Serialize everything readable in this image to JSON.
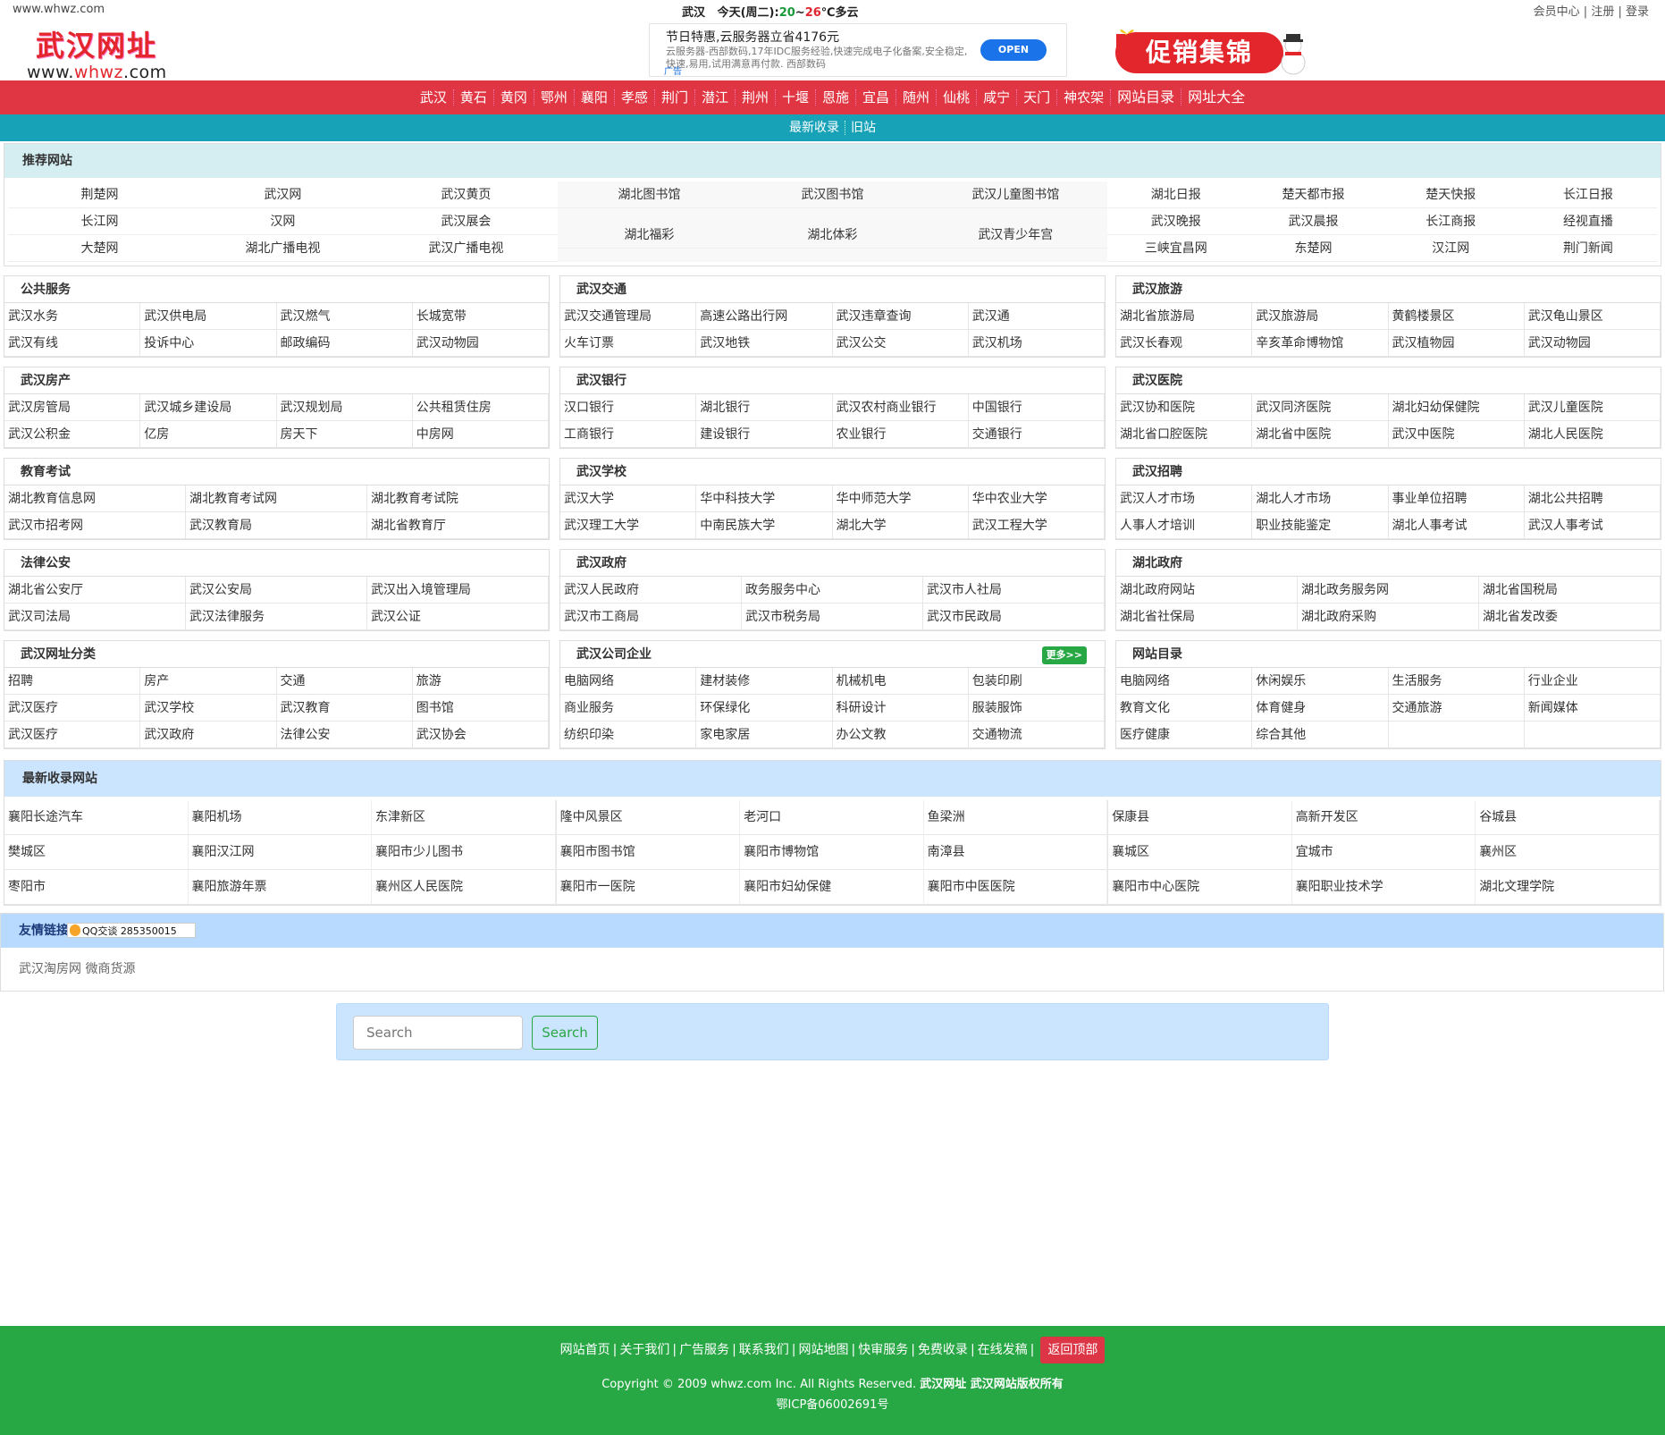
{
  "topbar": {
    "site": "www.whwz.com",
    "weather_city": "武汉",
    "weather_label": "今天(周二):",
    "weather_lo": "20",
    "weather_sep": "~",
    "weather_hi": "26",
    "weather_desc": "℃多云",
    "user_links": [
      "会员中心",
      "注册",
      "登录"
    ]
  },
  "logo": {
    "cn": "武汉网址",
    "en_pre": "www.",
    "en_mid": "whwz",
    "en_post": ".com"
  },
  "ad": {
    "title": "节日特惠,云服务器立省4176元",
    "desc": "云服务器-西部数码,17年IDC服务经验,快速完成电子化备案,安全稳定,快速,易用,试用满意再付款. 西部数码",
    "open": "OPEN",
    "tag": "广告"
  },
  "promo": {
    "text": "促销集锦"
  },
  "nav": [
    "武汉",
    "黄石",
    "黄冈",
    "鄂州",
    "襄阳",
    "孝感",
    "荆门",
    "潜江",
    "荆州",
    "十堰",
    "恩施",
    "宜昌",
    "随州",
    "仙桃",
    "咸宁",
    "天门",
    "神农架",
    "网站目录",
    "网址大全"
  ],
  "subnav": [
    "最新收录",
    "旧站"
  ],
  "recommend": {
    "title": "推荐网站",
    "cols": [
      [
        "荆楚网",
        "武汉网",
        "武汉黄页",
        "长江网",
        "汉网",
        "武汉展会",
        "大楚网",
        "湖北广播电视",
        "武汉广播电视"
      ],
      [
        "湖北图书馆",
        "武汉图书馆",
        "武汉儿童图书馆",
        "湖北福彩",
        "湖北体彩",
        "武汉青少年宫"
      ],
      [
        "湖北日报",
        "楚天都市报",
        "楚天快报",
        "长江日报",
        "武汉晚报",
        "武汉晨报",
        "长江商报",
        "经视直播",
        "三峡宜昌网",
        "东楚网",
        "汉江网",
        "荆门新闻"
      ]
    ]
  },
  "cats_row1": [
    {
      "title": "公共服务",
      "items": [
        "武汉水务",
        "武汉供电局",
        "武汉燃气",
        "长城宽带",
        "武汉有线",
        "投诉中心",
        "邮政编码",
        "武汉动物园"
      ]
    },
    {
      "title": "武汉交通",
      "items": [
        "武汉交通管理局",
        "高速公路出行网",
        "武汉违章查询",
        "武汉通",
        "火车订票",
        "武汉地铁",
        "武汉公交",
        "武汉机场"
      ]
    },
    {
      "title": "武汉旅游",
      "items": [
        "湖北省旅游局",
        "武汉旅游局",
        "黄鹤楼景区",
        "武汉龟山景区",
        "武汉长春观",
        "辛亥革命博物馆",
        "武汉植物园",
        "武汉动物园"
      ]
    }
  ],
  "cats_row2": [
    {
      "title": "武汉房产",
      "items": [
        "武汉房管局",
        "武汉城乡建设局",
        "武汉规划局",
        "公共租赁住房",
        "武汉公积金",
        "亿房",
        "房天下",
        "中房网"
      ]
    },
    {
      "title": "武汉银行",
      "items": [
        "汉口银行",
        "湖北银行",
        "武汉农村商业银行",
        "中国银行",
        "工商银行",
        "建设银行",
        "农业银行",
        "交通银行"
      ]
    },
    {
      "title": "武汉医院",
      "items": [
        "武汉协和医院",
        "武汉同济医院",
        "湖北妇幼保健院",
        "武汉儿童医院",
        "湖北省口腔医院",
        "湖北省中医院",
        "武汉中医院",
        "湖北人民医院"
      ]
    }
  ],
  "cats_row3": [
    {
      "title": "教育考试",
      "items": [
        "湖北教育信息网",
        "湖北教育考试网",
        "湖北教育考试院",
        "武汉市招考网",
        "武汉教育局",
        "湖北省教育厅"
      ]
    },
    {
      "title": "武汉学校",
      "items": [
        "武汉大学",
        "华中科技大学",
        "华中师范大学",
        "华中农业大学",
        "武汉理工大学",
        "中南民族大学",
        "湖北大学",
        "武汉工程大学"
      ]
    },
    {
      "title": "武汉招聘",
      "items": [
        "武汉人才市场",
        "湖北人才市场",
        "事业单位招聘",
        "湖北公共招聘",
        "人事人才培训",
        "职业技能鉴定",
        "湖北人事考试",
        "武汉人事考试"
      ]
    }
  ],
  "cats_row4": [
    {
      "title": "法律公安",
      "items": [
        "湖北省公安厅",
        "武汉公安局",
        "武汉出入境管理局",
        "武汉司法局",
        "武汉法律服务",
        "武汉公证"
      ]
    },
    {
      "title": "武汉政府",
      "items": [
        "武汉人民政府",
        "政务服务中心",
        "武汉市人社局",
        "武汉市工商局",
        "武汉市税务局",
        "武汉市民政局"
      ]
    },
    {
      "title": "湖北政府",
      "items": [
        "湖北政府网站",
        "湖北政务服务网",
        "湖北省国税局",
        "湖北省社保局",
        "湖北政府采购",
        "湖北省发改委"
      ]
    }
  ],
  "cats_row5": [
    {
      "title": "武汉网址分类",
      "items": [
        "招聘",
        "房产",
        "交通",
        "旅游",
        "武汉医疗",
        "武汉学校",
        "武汉教育",
        "图书馆",
        "武汉医疗",
        "武汉政府",
        "法律公安",
        "武汉协会"
      ]
    },
    {
      "title": "武汉公司企业",
      "more": "更多>>",
      "items": [
        "电脑网络",
        "建材装修",
        "机械机电",
        "包装印刷",
        "商业服务",
        "环保绿化",
        "科研设计",
        "服装服饰",
        "纺织印染",
        "家电家居",
        "办公文教",
        "交通物流"
      ]
    },
    {
      "title": "网站目录",
      "items": [
        "电脑网络",
        "休闲娱乐",
        "生活服务",
        "行业企业",
        "教育文化",
        "体育健身",
        "交通旅游",
        "新闻媒体",
        "医疗健康",
        "综合其他",
        "",
        ""
      ]
    }
  ],
  "latest": {
    "title": "最新收录网站",
    "cols": [
      [
        "襄阳长途汽车",
        "襄阳机场",
        "东津新区",
        "樊城区",
        "襄阳汉江网",
        "襄阳市少儿图书",
        "枣阳市",
        "襄阳旅游年票",
        "襄州区人民医院"
      ],
      [
        "隆中风景区",
        "老河口",
        "鱼梁洲",
        "襄阳市图书馆",
        "襄阳市博物馆",
        "南漳县",
        "襄阳市一医院",
        "襄阳市妇幼保健",
        "襄阳市中医医院"
      ],
      [
        "保康县",
        "高新开发区",
        "谷城县",
        "襄城区",
        "宜城市",
        "襄州区",
        "襄阳市中心医院",
        "襄阳职业技术学",
        "湖北文理学院"
      ]
    ]
  },
  "friend": {
    "title": "友情链接",
    "qq": "QQ交谈 285350015",
    "links": "武汉淘房网 微商货源"
  },
  "search": {
    "placeholder": "Search",
    "button": "Search"
  },
  "footer": {
    "links": [
      "网站首页",
      "关于我们",
      "广告服务",
      "联系我们",
      "网站地图",
      "快审服务",
      "免费收录",
      "在线发稿"
    ],
    "totop": "返回顶部",
    "copy_pre": "Copyright © 2009 whwz.com Inc. All Rights Reserved. ",
    "copy_bold": "武汉网址 武汉网站版权所有",
    "icp": "鄂ICP备06002691号"
  }
}
